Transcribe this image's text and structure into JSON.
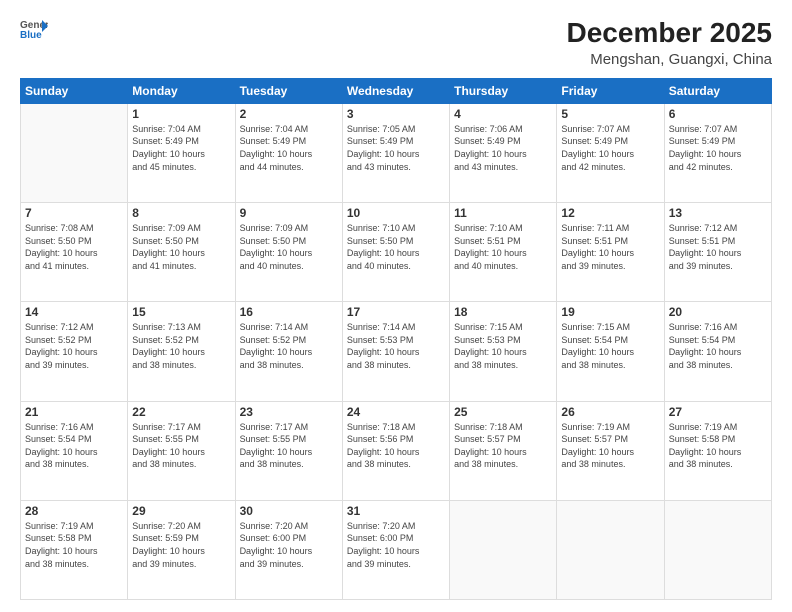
{
  "header": {
    "logo_general": "General",
    "logo_blue": "Blue",
    "month_year": "December 2025",
    "location": "Mengshan, Guangxi, China"
  },
  "days_of_week": [
    "Sunday",
    "Monday",
    "Tuesday",
    "Wednesday",
    "Thursday",
    "Friday",
    "Saturday"
  ],
  "weeks": [
    [
      {
        "day": "",
        "info": ""
      },
      {
        "day": "1",
        "info": "Sunrise: 7:04 AM\nSunset: 5:49 PM\nDaylight: 10 hours\nand 45 minutes."
      },
      {
        "day": "2",
        "info": "Sunrise: 7:04 AM\nSunset: 5:49 PM\nDaylight: 10 hours\nand 44 minutes."
      },
      {
        "day": "3",
        "info": "Sunrise: 7:05 AM\nSunset: 5:49 PM\nDaylight: 10 hours\nand 43 minutes."
      },
      {
        "day": "4",
        "info": "Sunrise: 7:06 AM\nSunset: 5:49 PM\nDaylight: 10 hours\nand 43 minutes."
      },
      {
        "day": "5",
        "info": "Sunrise: 7:07 AM\nSunset: 5:49 PM\nDaylight: 10 hours\nand 42 minutes."
      },
      {
        "day": "6",
        "info": "Sunrise: 7:07 AM\nSunset: 5:49 PM\nDaylight: 10 hours\nand 42 minutes."
      }
    ],
    [
      {
        "day": "7",
        "info": "Sunrise: 7:08 AM\nSunset: 5:50 PM\nDaylight: 10 hours\nand 41 minutes."
      },
      {
        "day": "8",
        "info": "Sunrise: 7:09 AM\nSunset: 5:50 PM\nDaylight: 10 hours\nand 41 minutes."
      },
      {
        "day": "9",
        "info": "Sunrise: 7:09 AM\nSunset: 5:50 PM\nDaylight: 10 hours\nand 40 minutes."
      },
      {
        "day": "10",
        "info": "Sunrise: 7:10 AM\nSunset: 5:50 PM\nDaylight: 10 hours\nand 40 minutes."
      },
      {
        "day": "11",
        "info": "Sunrise: 7:10 AM\nSunset: 5:51 PM\nDaylight: 10 hours\nand 40 minutes."
      },
      {
        "day": "12",
        "info": "Sunrise: 7:11 AM\nSunset: 5:51 PM\nDaylight: 10 hours\nand 39 minutes."
      },
      {
        "day": "13",
        "info": "Sunrise: 7:12 AM\nSunset: 5:51 PM\nDaylight: 10 hours\nand 39 minutes."
      }
    ],
    [
      {
        "day": "14",
        "info": "Sunrise: 7:12 AM\nSunset: 5:52 PM\nDaylight: 10 hours\nand 39 minutes."
      },
      {
        "day": "15",
        "info": "Sunrise: 7:13 AM\nSunset: 5:52 PM\nDaylight: 10 hours\nand 38 minutes."
      },
      {
        "day": "16",
        "info": "Sunrise: 7:14 AM\nSunset: 5:52 PM\nDaylight: 10 hours\nand 38 minutes."
      },
      {
        "day": "17",
        "info": "Sunrise: 7:14 AM\nSunset: 5:53 PM\nDaylight: 10 hours\nand 38 minutes."
      },
      {
        "day": "18",
        "info": "Sunrise: 7:15 AM\nSunset: 5:53 PM\nDaylight: 10 hours\nand 38 minutes."
      },
      {
        "day": "19",
        "info": "Sunrise: 7:15 AM\nSunset: 5:54 PM\nDaylight: 10 hours\nand 38 minutes."
      },
      {
        "day": "20",
        "info": "Sunrise: 7:16 AM\nSunset: 5:54 PM\nDaylight: 10 hours\nand 38 minutes."
      }
    ],
    [
      {
        "day": "21",
        "info": "Sunrise: 7:16 AM\nSunset: 5:54 PM\nDaylight: 10 hours\nand 38 minutes."
      },
      {
        "day": "22",
        "info": "Sunrise: 7:17 AM\nSunset: 5:55 PM\nDaylight: 10 hours\nand 38 minutes."
      },
      {
        "day": "23",
        "info": "Sunrise: 7:17 AM\nSunset: 5:55 PM\nDaylight: 10 hours\nand 38 minutes."
      },
      {
        "day": "24",
        "info": "Sunrise: 7:18 AM\nSunset: 5:56 PM\nDaylight: 10 hours\nand 38 minutes."
      },
      {
        "day": "25",
        "info": "Sunrise: 7:18 AM\nSunset: 5:57 PM\nDaylight: 10 hours\nand 38 minutes."
      },
      {
        "day": "26",
        "info": "Sunrise: 7:19 AM\nSunset: 5:57 PM\nDaylight: 10 hours\nand 38 minutes."
      },
      {
        "day": "27",
        "info": "Sunrise: 7:19 AM\nSunset: 5:58 PM\nDaylight: 10 hours\nand 38 minutes."
      }
    ],
    [
      {
        "day": "28",
        "info": "Sunrise: 7:19 AM\nSunset: 5:58 PM\nDaylight: 10 hours\nand 38 minutes."
      },
      {
        "day": "29",
        "info": "Sunrise: 7:20 AM\nSunset: 5:59 PM\nDaylight: 10 hours\nand 39 minutes."
      },
      {
        "day": "30",
        "info": "Sunrise: 7:20 AM\nSunset: 6:00 PM\nDaylight: 10 hours\nand 39 minutes."
      },
      {
        "day": "31",
        "info": "Sunrise: 7:20 AM\nSunset: 6:00 PM\nDaylight: 10 hours\nand 39 minutes."
      },
      {
        "day": "",
        "info": ""
      },
      {
        "day": "",
        "info": ""
      },
      {
        "day": "",
        "info": ""
      }
    ]
  ]
}
